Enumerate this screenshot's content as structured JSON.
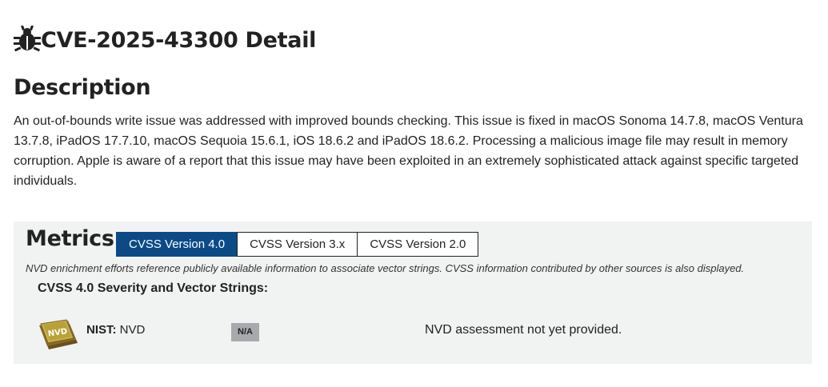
{
  "header": {
    "icon": "bug-icon",
    "title": "CVE-2025-43300 Detail"
  },
  "description": {
    "heading": "Description",
    "text": "An out-of-bounds write issue was addressed with improved bounds checking. This issue is fixed in macOS Sonoma 14.7.8, macOS Ventura 13.7.8, iPadOS 17.7.10, macOS Sequoia 15.6.1, iOS 18.6.2 and iPadOS 18.6.2. Processing a malicious image file may result in memory corruption. Apple is aware of a report that this issue may have been exploited in an extremely sophisticated attack against specific targeted individuals."
  },
  "metrics": {
    "heading": "Metrics",
    "tabs": [
      {
        "label": "CVSS Version 4.0",
        "active": true
      },
      {
        "label": "CVSS Version 3.x",
        "active": false
      },
      {
        "label": "CVSS Version 2.0",
        "active": false
      }
    ],
    "note": "NVD enrichment efforts reference publicly available information to associate vector strings. CVSS information contributed by other sources is also displayed.",
    "severity_heading": "CVSS 4.0 Severity and Vector Strings:",
    "rows": [
      {
        "logo": "nvd-logo",
        "logo_text": "NVD",
        "source_label": "NIST:",
        "source_value": "NVD",
        "score_badge": "N/A",
        "assessment": "NVD assessment not yet provided."
      }
    ]
  },
  "colors": {
    "active_tab": "#0b4a86",
    "panel_bg": "#f1f2f2",
    "badge_bg": "#a7a9ac",
    "logo_gold": "#b8a237",
    "logo_brown": "#6b4f1d"
  }
}
